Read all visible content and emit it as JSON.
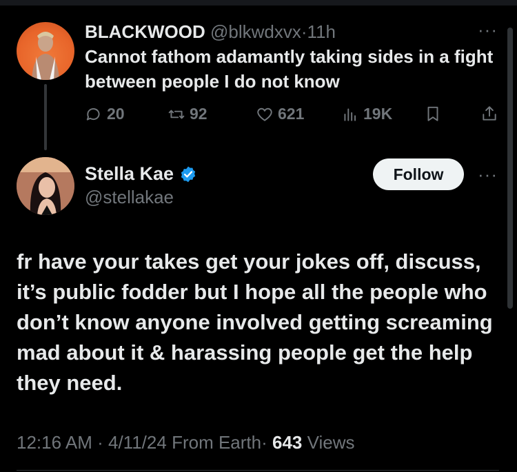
{
  "parent_tweet": {
    "display_name": "BLACKWOOD",
    "handle": "@blkwdxvx",
    "separator": "·",
    "time": "11h",
    "text": "Cannot fathom adamantly taking sides in a fight between people I do not know",
    "more_icon": "···",
    "actions": {
      "replies": "20",
      "retweets": "92",
      "likes": "621",
      "views": "19K"
    }
  },
  "main_tweet": {
    "display_name": "Stella Kae",
    "handle": "@stellakae",
    "verified": true,
    "follow_label": "Follow",
    "more_icon": "···",
    "text": "fr have your takes get your jokes off, discuss, it’s public fodder but I hope all the people who don’t know anyone involved getting screaming mad about it & harassing people get the help they need.",
    "meta": {
      "time": "12:16 AM",
      "sep1": "·",
      "date": "4/11/24",
      "source": "From Earth",
      "sep2": "·",
      "views_count": "643",
      "views_label": "Views"
    }
  },
  "colors": {
    "background": "#000000",
    "text": "#e7e9ea",
    "muted": "#71767b",
    "verified": "#1d9bf0",
    "follow_bg": "#eff3f4"
  }
}
